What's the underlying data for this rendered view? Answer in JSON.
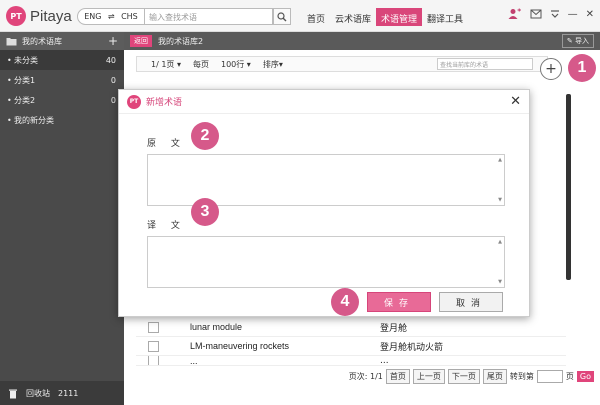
{
  "app": {
    "logo_mark": "PT",
    "name": "Pitaya"
  },
  "topbar": {
    "lang_from": "ENG",
    "lang_swap": "⇌",
    "lang_to": "CHS",
    "search_placeholder": "输入查找术语",
    "tabs": [
      {
        "label": "首页",
        "active": false
      },
      {
        "label": "云术语库",
        "active": false
      },
      {
        "label": "术语管理",
        "active": true
      },
      {
        "label": "翻译工具",
        "active": false
      }
    ]
  },
  "sidebar": {
    "header": "我的术语库",
    "items": [
      {
        "label": "未分类",
        "count": "40",
        "active": true
      },
      {
        "label": "分类1",
        "count": "0",
        "active": false
      },
      {
        "label": "分类2",
        "count": "0",
        "active": false
      },
      {
        "label": "我的新分类",
        "count": "",
        "active": false
      }
    ],
    "recycle_label": "回收站",
    "recycle_count": "2111"
  },
  "main": {
    "back_label": "返回",
    "crumb_title": "我的术语库2",
    "import_label": "导入",
    "page_indicator": "1/ 1页",
    "per_page_label": "每页",
    "per_page_value": "100行",
    "sort_label": "排序",
    "search_placeholder": "查找当前库的术语",
    "add_symbol": "+",
    "rows": [
      {
        "source": "lunar module",
        "target": "登月舱"
      },
      {
        "source": "LM-maneuvering rockets",
        "target": "登月舱机动火箭"
      },
      {
        "source": "...",
        "target": "..."
      }
    ],
    "footer": {
      "page_text": "页次: 1/1",
      "first": "首页",
      "prev": "上一页",
      "next": "下一页",
      "last": "尾页",
      "goto": "转到第",
      "page_unit": "页",
      "go": "Go"
    }
  },
  "modal": {
    "logo_mark": "PT",
    "title": "新增术语",
    "source_label": "原 文",
    "target_label": "译 文",
    "save_label": "保存",
    "cancel_label": "取消"
  },
  "callouts": [
    "1",
    "2",
    "3",
    "4"
  ],
  "colors": {
    "accent": "#e0457b",
    "sidebar": "#4a4a4a",
    "callout": "#d6598a"
  }
}
